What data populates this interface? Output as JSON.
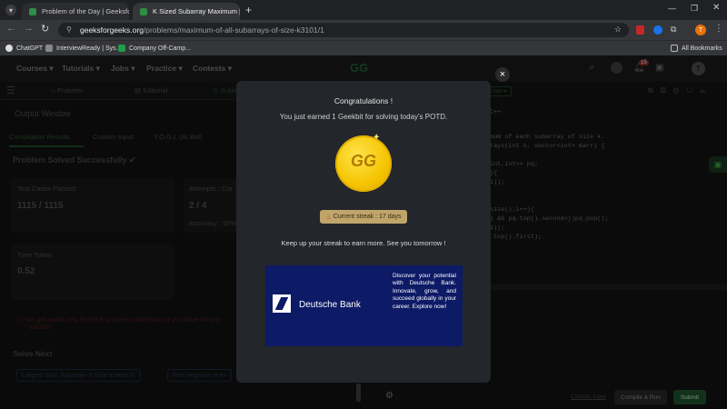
{
  "browser": {
    "tabs": [
      {
        "title": "Problem of the Day | GeeksforG",
        "active": false
      },
      {
        "title": "K Sized Subarray Maximum | P",
        "active": true
      }
    ],
    "url_host": "geeksforgeeks.org",
    "url_path": "/problems/maximum-of-all-subarrays-of-size-k3101/1",
    "bookmarks": [
      "ChatGPT",
      "InterviewReady | Sys...",
      "Company Off-Camp..."
    ],
    "all_bookmarks": "All Bookmarks",
    "profile_initial": "T"
  },
  "nav": {
    "items": [
      "Courses",
      "Tutorials",
      "Jobs",
      "Practice",
      "Contests"
    ],
    "notification_count": "15",
    "avatar": "T"
  },
  "left": {
    "tabs": [
      "Problem",
      "Editorial",
      "Submissions"
    ],
    "output_window": "Output Window",
    "result_tabs": [
      "Compilation Results",
      "Custom Input",
      "Y.O.G.I. (AI Bot)"
    ],
    "solved": "Problem Solved Successfully",
    "test_cases_label": "Test Cases Passed",
    "test_cases_value": "1115 / 1115",
    "attempts_label": "Attempts : Cor",
    "attempts_value": "2 / 4",
    "accuracy_label": "Accuracy : 50%",
    "time_label": "Time Taken",
    "time_value": "0.52",
    "warning": "You get marks only for the first correct submission if you solve the pro",
    "warning2": "solution.",
    "solve_next": "Solve Next",
    "next_1": "Largest Sum Subarray of Size at least K",
    "next_2": "First negative in ev"
  },
  "right": {
    "lang": "C++",
    "code": [
      "mum of each subarray of size k.",
      "rays(int k, vector<int> &arr) {",
      "",
      "int,int>> pq;",
      "){",
      "i));",
      "",
      "",
      "size();i++){",
      ") && pq.top().second<j)pq.pop();",
      "i));",
      ".top().first);"
    ],
    "custom_input": "Custom Input",
    "compile_run": "Compile & Run",
    "submit": "Submit"
  },
  "modal": {
    "title": "Congratulations !",
    "subtitle": "You just earned 1 Geekbit for solving today's POTD.",
    "coin_glyph": "GG",
    "streak": "Current streak : 17 days",
    "footer": "Keep up your streak to earn more. See you tomorrow !",
    "ad_brand": "Deutsche Bank",
    "ad_text": "Discover your potential with Deutsche Bank. Innovate, grow, and succeed globally in your career. Explore now!",
    "close": "×"
  }
}
